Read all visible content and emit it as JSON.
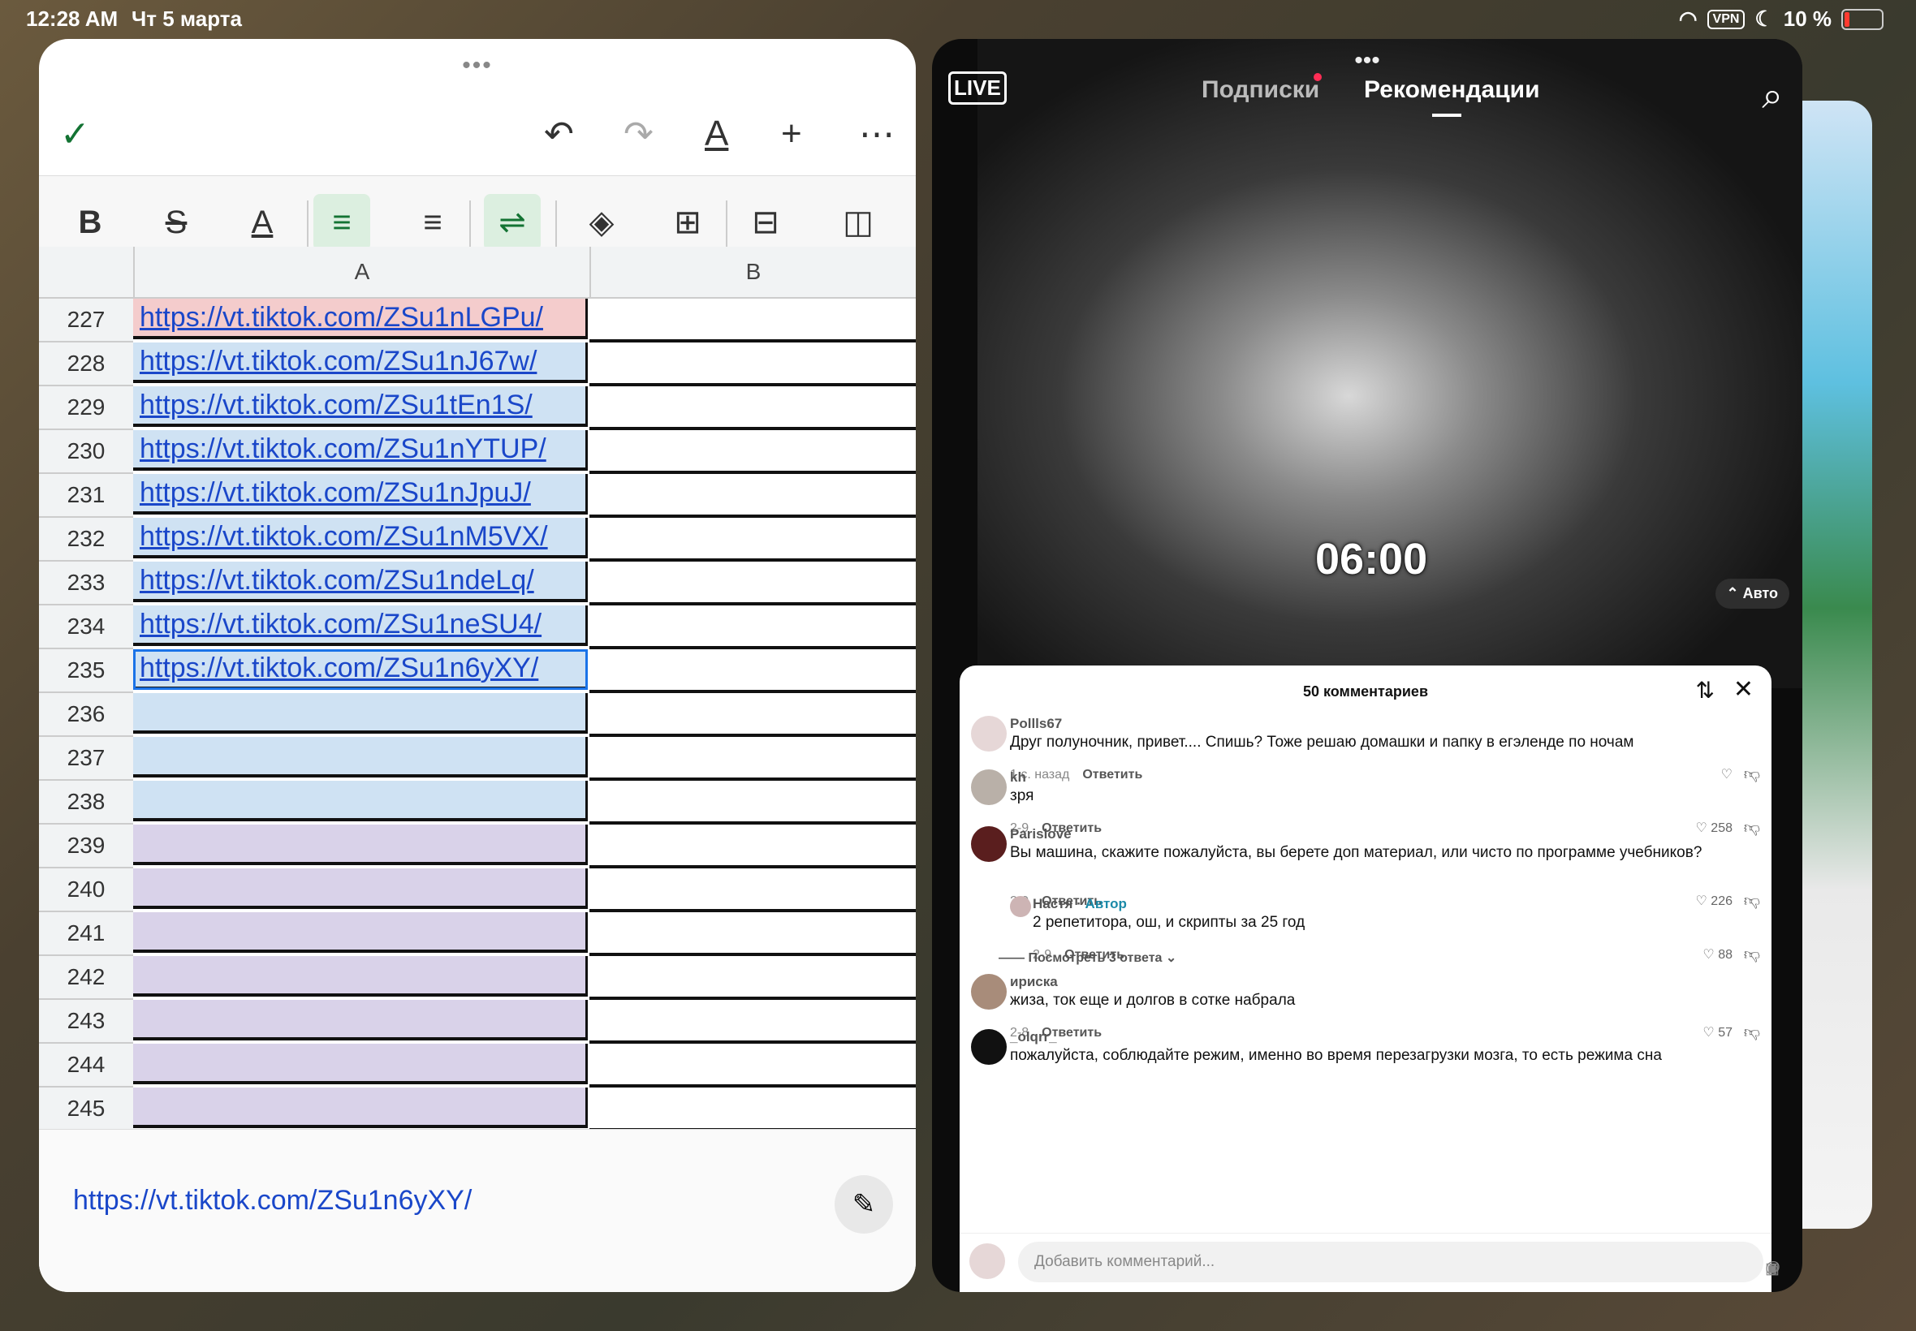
{
  "status": {
    "time": "12:28 AM",
    "date": "Чт 5 марта",
    "vpn": "VPN",
    "battery": "10 %"
  },
  "sheet": {
    "columns": [
      "A",
      "B"
    ],
    "rows": [
      {
        "num": "227",
        "value": "https://vt.tiktok.com/ZSu1nLGPu/",
        "bg": "#f4cccc"
      },
      {
        "num": "228",
        "value": "https://vt.tiktok.com/ZSu1nJ67w/",
        "bg": "#cfe2f3"
      },
      {
        "num": "229",
        "value": "https://vt.tiktok.com/ZSu1tEn1S/",
        "bg": "#cfe2f3"
      },
      {
        "num": "230",
        "value": "https://vt.tiktok.com/ZSu1nYTUP/",
        "bg": "#cfe2f3"
      },
      {
        "num": "231",
        "value": "https://vt.tiktok.com/ZSu1nJpuJ/",
        "bg": "#cfe2f3"
      },
      {
        "num": "232",
        "value": "https://vt.tiktok.com/ZSu1nM5VX/",
        "bg": "#cfe2f3"
      },
      {
        "num": "233",
        "value": "https://vt.tiktok.com/ZSu1ndeLq/",
        "bg": "#cfe2f3"
      },
      {
        "num": "234",
        "value": "https://vt.tiktok.com/ZSu1neSU4/",
        "bg": "#cfe2f3"
      },
      {
        "num": "235",
        "value": "https://vt.tiktok.com/ZSu1n6yXY/",
        "bg": "#cfe2f3"
      },
      {
        "num": "236",
        "value": "",
        "bg": "#cfe2f3"
      },
      {
        "num": "237",
        "value": "",
        "bg": "#cfe2f3"
      },
      {
        "num": "238",
        "value": "",
        "bg": "#cfe2f3"
      },
      {
        "num": "239",
        "value": "",
        "bg": "#d9d2e9"
      },
      {
        "num": "240",
        "value": "",
        "bg": "#d9d2e9"
      },
      {
        "num": "241",
        "value": "",
        "bg": "#d9d2e9"
      },
      {
        "num": "242",
        "value": "",
        "bg": "#d9d2e9"
      },
      {
        "num": "243",
        "value": "",
        "bg": "#d9d2e9"
      },
      {
        "num": "244",
        "value": "",
        "bg": "#d9d2e9"
      },
      {
        "num": "245",
        "value": "",
        "bg": "#d9d2e9"
      }
    ],
    "formula_value": "https://vt.tiktok.com/ZSu1n6yXY/"
  },
  "tiktok": {
    "live": "LIVE",
    "tab_following": "Подписки",
    "tab_foryou": "Рекомендации",
    "timer": "06:00",
    "auto": "Авто",
    "comments_title": "50 комментариев",
    "reply_label": "Ответить",
    "comments": [
      {
        "name": "Pollls67",
        "text": "Друг полуночник, привет.... Спишь? Тоже решаю домашки и папку в егэленде по ночам",
        "time": "1 с. назад",
        "likes": ""
      },
      {
        "name": "kh",
        "text": "зря",
        "time": "2-9",
        "likes": "258"
      },
      {
        "name": "Parislove",
        "text": "Вы машина, скажите пожалуйста, вы берете доп материал, или чисто по программе учебников?",
        "time": "2-9",
        "likes": "226"
      },
      {
        "name": "ириска",
        "text": "жиза, ток еще и долгов в сотке набрала",
        "time": "2-8",
        "likes": "57"
      },
      {
        "name": "_olqrr_",
        "text": "пожалуйста, соблюдайте режим, именно во время перезагрузки мозга, то есть режима сна"
      }
    ],
    "reply": {
      "name": "Настя",
      "author_tag": "Автор",
      "text": "2 репетитора, ош, и скрипты за 25 год",
      "time": "2-9",
      "likes": "88"
    },
    "view_replies": "Посмотреть 3 ответа",
    "add_comment_placeholder": "Добавить комментарий..."
  }
}
